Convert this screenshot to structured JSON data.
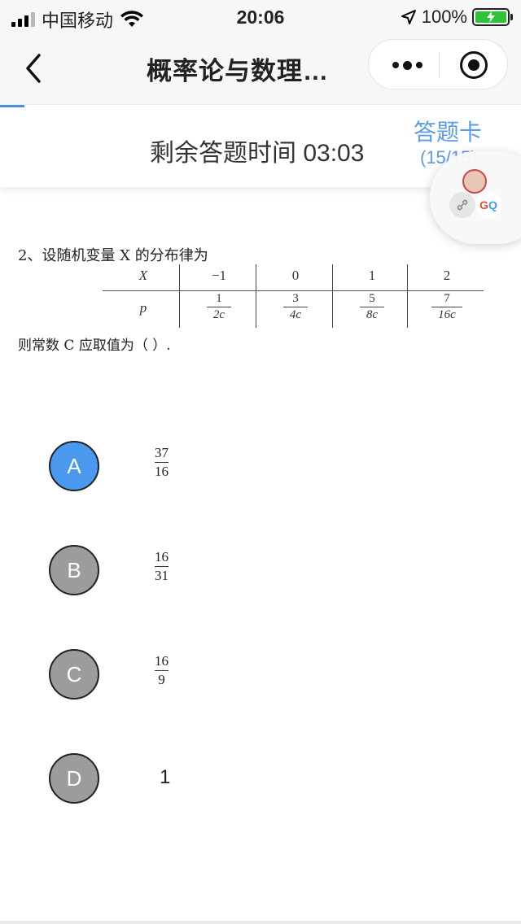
{
  "status_bar": {
    "carrier": "中国移动",
    "time": "20:06",
    "battery": "100%"
  },
  "nav": {
    "title": "概率论与数理…"
  },
  "timer": {
    "label": "剩余答题时间 03:03",
    "answer_card": "答题卡",
    "count": "(15/15)"
  },
  "question": {
    "stem": "2、设随机变量 X 的分布律为",
    "table": {
      "header_label": "X",
      "values": [
        "−1",
        "0",
        "1",
        "2"
      ],
      "prob_label": "p",
      "probs": [
        {
          "num": "1",
          "den": "2c"
        },
        {
          "num": "3",
          "den": "4c"
        },
        {
          "num": "5",
          "den": "8c"
        },
        {
          "num": "7",
          "den": "16c"
        }
      ]
    },
    "tail": "则常数 C  应取值为（        ）."
  },
  "options": [
    {
      "letter": "A",
      "num": "37",
      "den": "16",
      "selected": true
    },
    {
      "letter": "B",
      "num": "16",
      "den": "31",
      "selected": false
    },
    {
      "letter": "C",
      "num": "16",
      "den": "9",
      "selected": false
    },
    {
      "letter": "D",
      "text": "1",
      "selected": false
    }
  ],
  "colors": {
    "selected": "#4b98ef",
    "unselected": "#9c9c9c",
    "accent": "#5a9de6"
  }
}
